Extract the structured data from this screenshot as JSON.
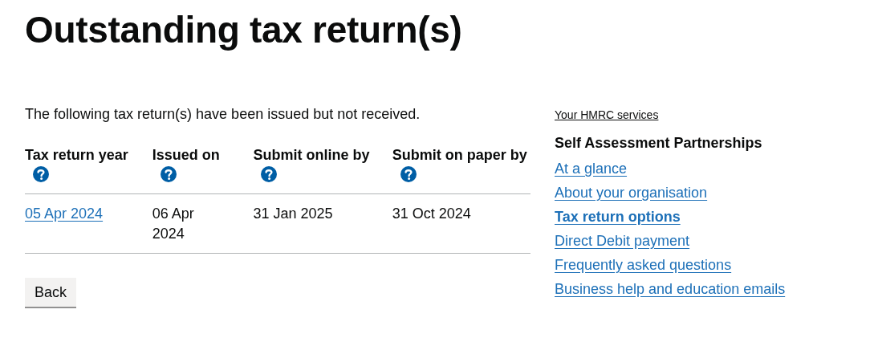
{
  "heading": "Outstanding tax return(s)",
  "intro": "The following tax return(s) have been issued but not received.",
  "table": {
    "columns": [
      {
        "label": "Tax return year",
        "help": true
      },
      {
        "label": "Issued on",
        "help": true
      },
      {
        "label": "Submit online by",
        "help": true
      },
      {
        "label": "Submit on paper by",
        "help": true
      }
    ],
    "rows": [
      {
        "cells": [
          {
            "text": "05 Apr 2024",
            "kind": "link"
          },
          {
            "text": "06 Apr 2024",
            "kind": "text"
          },
          {
            "text": "31 Jan 2025",
            "kind": "text"
          },
          {
            "text": "31 Oct 2024",
            "kind": "text"
          }
        ]
      }
    ]
  },
  "back_button": "Back",
  "sidebar": {
    "services_link": "Your HMRC services",
    "title": "Self Assessment Partnerships",
    "items": [
      {
        "label": "At a glance",
        "selected": false
      },
      {
        "label": "About your organisation",
        "selected": false
      },
      {
        "label": "Tax return options",
        "selected": true
      },
      {
        "label": "Direct Debit payment",
        "selected": false
      },
      {
        "label": "Frequently asked questions",
        "selected": false
      },
      {
        "label": "Business help and education emails",
        "selected": false
      }
    ]
  }
}
